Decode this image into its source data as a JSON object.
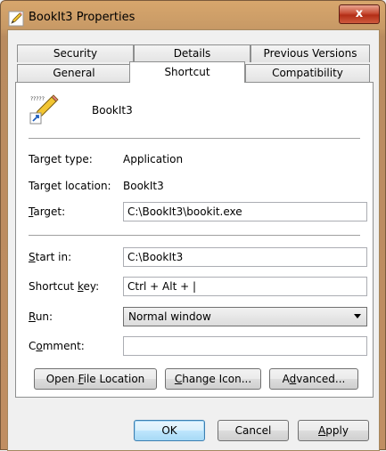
{
  "window": {
    "title": "BookIt3 Properties",
    "close_glyph": "x"
  },
  "tabs": {
    "row1": [
      "Security",
      "Details",
      "Previous Versions"
    ],
    "row2": [
      "General",
      "Shortcut",
      "Compatibility"
    ],
    "active": "Shortcut"
  },
  "shortcut": {
    "name": "BookIt3",
    "target_type_label": "Target type:",
    "target_type_value": "Application",
    "target_location_label": "Target location:",
    "target_location_value": "BookIt3",
    "target_label": "Target:",
    "target_value": "C:\\BookIt3\\bookit.exe",
    "start_in_label": "Start in:",
    "start_in_value": "C:\\BookIt3",
    "shortcut_key_label": "Shortcut key:",
    "shortcut_key_value": "Ctrl + Alt + |",
    "run_label": "Run:",
    "run_value": "Normal window",
    "comment_label": "Comment:",
    "comment_value": ""
  },
  "page_buttons": {
    "open_file_location": "Open File Location",
    "change_icon": "Change Icon...",
    "advanced": "Advanced..."
  },
  "dialog_buttons": {
    "ok": "OK",
    "cancel": "Cancel",
    "apply": "Apply"
  },
  "icons": {
    "app": "pencil-shortcut-icon",
    "close": "close-icon",
    "dropdown": "chevron-down-icon"
  },
  "colors": {
    "accent_border": "#3c7fb1",
    "close_red": "#c74c34",
    "frame": "#c89a66"
  }
}
